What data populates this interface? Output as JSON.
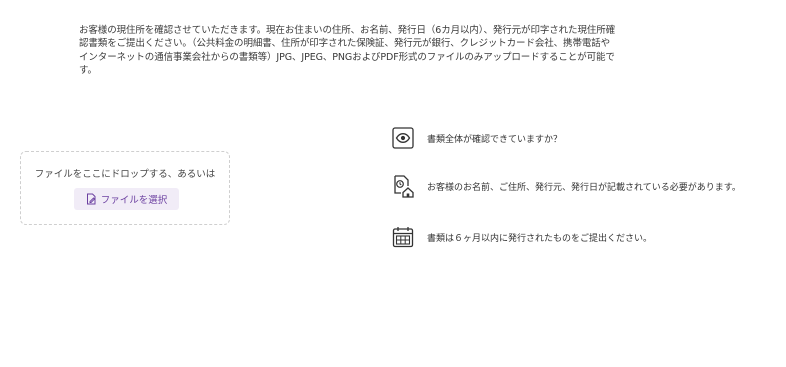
{
  "intro": {
    "text": "お客様の現住所を確認させていただきます。現在お住まいの住所、お名前、発行日（6カ月以内）、発行元が印字された現住所確認書類をご提出ください。（公共料金の明細書、住所が印字された保険証、発行元が銀行、クレジットカード会社、携帯電話やインターネットの通信事業会社からの書類等）JPG、JPEG、PNGおよびPDF形式のファイルのみアップロードすることが可能です。"
  },
  "upload": {
    "drop_text": "ファイルをここにドロップする、あるいは",
    "button_label": "ファイルを選択",
    "button_icon": "file-edit-icon"
  },
  "tips": [
    {
      "icon": "eye-icon",
      "text": "書類全体が確認できていますか？"
    },
    {
      "icon": "home-clock-icon",
      "text": "お客様のお名前、ご住所、発行元、発行日が記載されている必要があります。"
    },
    {
      "icon": "calendar-icon",
      "text": "書類は６ヶ月以内に発行されたものをご提出ください。"
    }
  ],
  "colors": {
    "accent": "#6b3fa0",
    "button_bg": "#f1ecf7",
    "text": "#333333",
    "border": "#cfcfcf"
  }
}
